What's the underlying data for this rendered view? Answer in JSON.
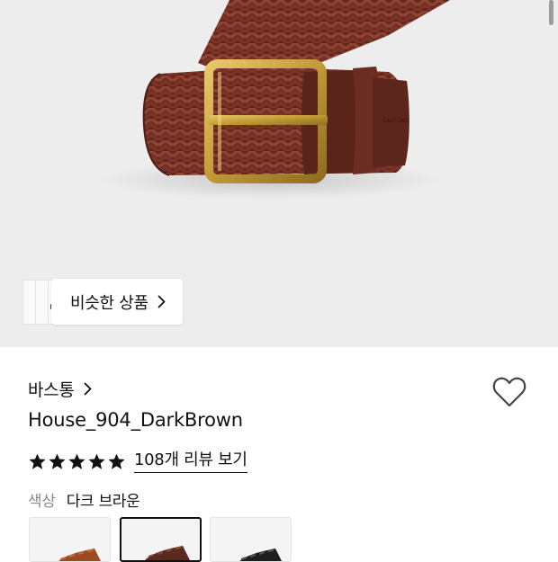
{
  "product_image": {
    "icon": "braided-leather-belt-image",
    "belt_color": "#6b2e22",
    "buckle_color": "#c9a33c"
  },
  "similar_products": {
    "label": "비슷한 상품",
    "icon": "chevron-right-icon"
  },
  "brand": {
    "name": "바스통",
    "icon": "chevron-right-icon"
  },
  "product": {
    "title": "House_904_DarkBrown"
  },
  "rating": {
    "stars": 5,
    "max_stars": 5,
    "review_link": "108개 리뷰 보기"
  },
  "color_option": {
    "label": "색상",
    "selected": "다크 브라운",
    "swatches": [
      {
        "name": "light-brown",
        "color": "#9b4a22",
        "selected": false
      },
      {
        "name": "dark-brown",
        "color": "#5a2a1e",
        "selected": true
      },
      {
        "name": "black",
        "color": "#1e1e1e",
        "selected": false
      }
    ]
  }
}
